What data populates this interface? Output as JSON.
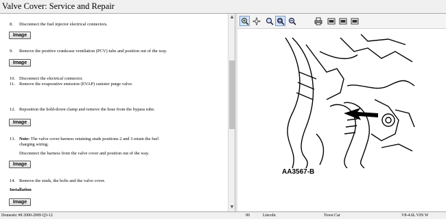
{
  "window": {
    "title": "Valve Cover:  Service and Repair"
  },
  "procedure": {
    "steps": [
      {
        "num": "8.",
        "text": "Disconnect the fuel injector electrical connectors."
      },
      {
        "num": "9.",
        "text": "Remove the positive crankcase ventilation (PCV) tube and position out of the way."
      },
      {
        "num": "10.",
        "text": "Disconnect the electrical connector."
      },
      {
        "num": "11.",
        "text": "Remove the evaporative emission (EVAP) canister purge valve."
      },
      {
        "num": "12.",
        "text": "Reposition the hold-down clamp and remove the hose from the bypass tube."
      },
      {
        "num": "13.",
        "note_label": "Note:",
        "text": "The valve cover harness retaining studs positions 2 and 3 retain the fuel",
        "text_cont": "charging wiring.",
        "sub_text": "Disconnect the harness from the valve cover and position out of the way."
      },
      {
        "num": "14.",
        "text": "Remove the studs, the bolts and the valve cover."
      }
    ],
    "image_button_label": "Image",
    "installation_heading": "Installation"
  },
  "viewer": {
    "toolbar_icons": [
      "zoom-in-icon",
      "pan-icon",
      "zoom-fit-icon",
      "zoom-region-icon",
      "zoom-out-icon",
      "print-icon",
      "image-icon",
      "image-icon",
      "image-icon"
    ],
    "figure_label": "AA3567-B"
  },
  "status_bar": {
    "doc": "Domestic #8 2000-2009 Q3-12",
    "code": "00",
    "make": "Lincoln",
    "model": "Town Car",
    "engine": "V8-4.6L VIN W"
  }
}
